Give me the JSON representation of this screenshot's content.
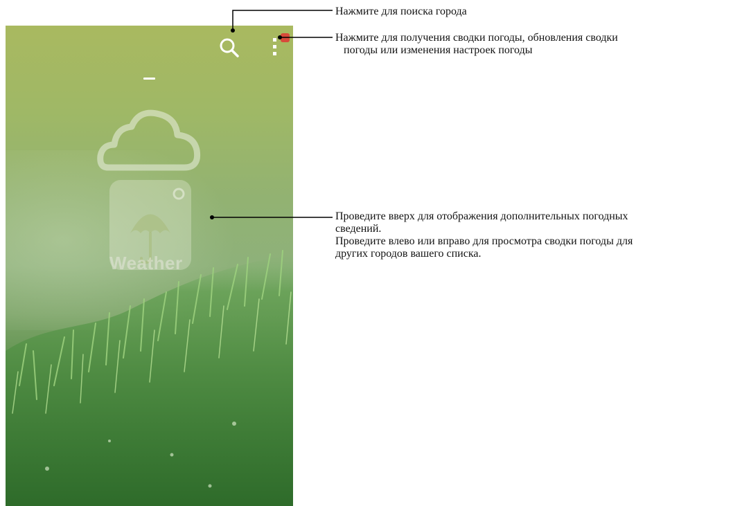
{
  "callouts": {
    "search": "Нажмите для поиска города",
    "menu_line1": "Нажмите для получения сводки погоды, обновления сводки",
    "menu_line2": "погоды или изменения настроек погоды",
    "swipe_line1": "Проведите вверх для отображения дополнительных погодных",
    "swipe_line2": "сведений.",
    "swipe_line3": "Проведите влево или вправо для просмотра сводки погоды для",
    "swipe_line4": "других городов вашего списка."
  },
  "app": {
    "logo_text": "Weather"
  },
  "icons": {
    "search": "search-icon",
    "menu": "more-vertical-icon",
    "cloud": "cloud-icon",
    "umbrella": "umbrella-icon"
  },
  "colors": {
    "callout_line": "#000000",
    "badge": "#d84a3a"
  }
}
